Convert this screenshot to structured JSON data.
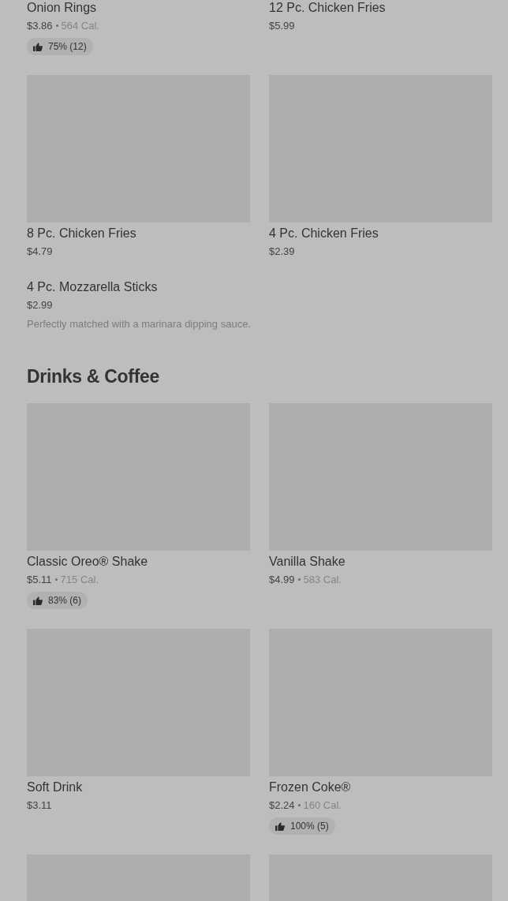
{
  "sections": [
    {
      "items": [
        {
          "kind": "card",
          "image": false,
          "name": "Onion Rings",
          "price": "$3.86",
          "calories": "564 Cal.",
          "rating": "75% (12)"
        },
        {
          "kind": "card",
          "image": false,
          "name": "12 Pc. Chicken Fries",
          "price": "$5.99"
        },
        {
          "kind": "card",
          "image": true,
          "name": "8 Pc. Chicken Fries",
          "price": "$4.79"
        },
        {
          "kind": "card",
          "image": true,
          "name": "4 Pc. Chicken Fries",
          "price": "$2.39"
        },
        {
          "kind": "wide",
          "name": "4 Pc. Mozzarella Sticks",
          "price": "$2.99",
          "description": "Perfectly matched with a marinara dipping sauce."
        }
      ]
    },
    {
      "heading": "Drinks & Coffee",
      "items": [
        {
          "kind": "card",
          "image": true,
          "name": "Classic Oreo® Shake",
          "price": "$5.11",
          "calories": "715 Cal.",
          "rating": "83% (6)"
        },
        {
          "kind": "card",
          "image": true,
          "name": "Vanilla Shake",
          "price": "$4.99",
          "calories": "583 Cal."
        },
        {
          "kind": "card",
          "image": true,
          "name": "Soft Drink",
          "price": "$3.11"
        },
        {
          "kind": "card",
          "image": true,
          "name": "Frozen Coke®",
          "price": "$2.24",
          "calories": "160 Cal.",
          "rating": "100% (5)"
        },
        {
          "kind": "card",
          "image": true
        },
        {
          "kind": "card",
          "image": true
        }
      ]
    }
  ]
}
